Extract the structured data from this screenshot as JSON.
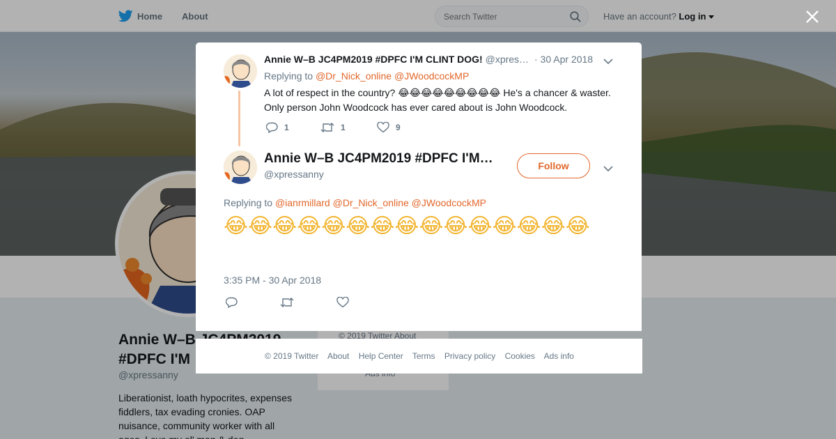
{
  "nav": {
    "home": "Home",
    "about": "About",
    "search_placeholder": "Search Twitter",
    "have_account": "Have an account?",
    "login": "Log in"
  },
  "background_profile": {
    "name": "Annie W–B JC4PM2019 #DPFC I'M",
    "handle": "@xpressanny",
    "bio": "Liberationist, loath hypocrites, expenses fiddlers, tax evading cronies. OAP nuisance, community worker with all ages. Love my ol' man & dog",
    "footer_line1": "© 2019 Twitter   About",
    "footer_line2": "Ads info"
  },
  "parent_tweet": {
    "name": "Annie W–B JC4PM2019 #DPFC I'M CLINT DOG!",
    "handle": "@xpres…",
    "date": "· 30 Apr 2018",
    "replying_to_label": "Replying to",
    "mentions": [
      "@Dr_Nick_online",
      "@JWoodcockMP"
    ],
    "text_prefix": "A lot of respect in the country?",
    "emojis": "😂😂😂😂😂😂😂😂😂",
    "text_suffix": "He's a chancer & waster. Only person John Woodcock has ever cared about is John Woodcock.",
    "reply_count": "1",
    "retweet_count": "1",
    "like_count": "9"
  },
  "main_tweet": {
    "name": "Annie W–B JC4PM2019 #DPFC I'M…",
    "handle": "@xpressanny",
    "follow_label": "Follow",
    "replying_to_label": "Replying to",
    "mentions": [
      "@ianrmillard",
      "@Dr_Nick_online",
      "@JWoodcockMP"
    ],
    "text": "😂😂😂😂😂😂😂😂😂😂😂😂😂😂😂",
    "timestamp": "3:35 PM - 30 Apr 2018"
  },
  "footer": {
    "copyright": "© 2019 Twitter",
    "links": [
      "About",
      "Help Center",
      "Terms",
      "Privacy policy",
      "Cookies",
      "Ads info"
    ]
  },
  "colors": {
    "accent": "#e2672b",
    "twitter_blue": "#1da1f2",
    "emoji_yellow": "#f2b531"
  },
  "icons": [
    "twitter-bird-icon",
    "search-icon",
    "caret-down-icon",
    "close-icon",
    "chevron-down-icon",
    "reply-icon",
    "retweet-icon",
    "like-icon"
  ]
}
